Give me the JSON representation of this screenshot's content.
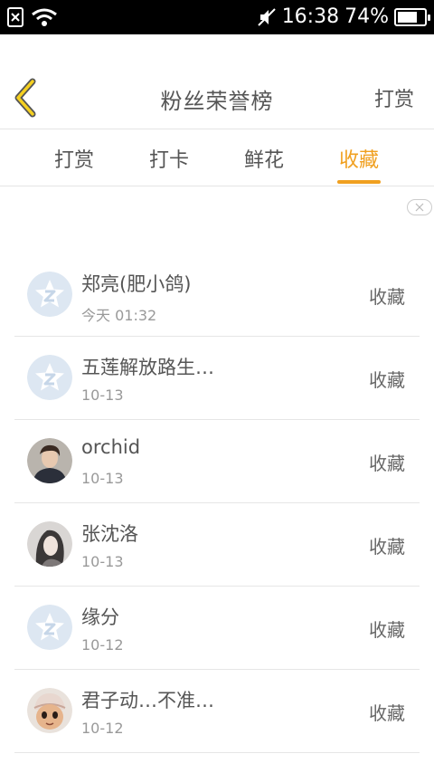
{
  "status_bar": {
    "time": "16:38",
    "battery_percent_text": "74%",
    "battery_level": 0.74
  },
  "header": {
    "title": "粉丝荣誉榜",
    "action_label": "打赏",
    "accent_color": "#f0a020"
  },
  "tabs": [
    {
      "label": "打赏",
      "active": false
    },
    {
      "label": "打卡",
      "active": false
    },
    {
      "label": "鲜花",
      "active": false
    },
    {
      "label": "收藏",
      "active": true
    }
  ],
  "fans": [
    {
      "name": "郑亮(肥小鸽)",
      "date": "今天 01:32",
      "action": "收藏",
      "avatar": "default-star-avatar"
    },
    {
      "name": "五莲解放路生…",
      "date": "10-13",
      "action": "收藏",
      "avatar": "default-star-avatar"
    },
    {
      "name": "orchid",
      "date": "10-13",
      "action": "收藏",
      "avatar": "photo-avatar-man"
    },
    {
      "name": "张沈洛",
      "date": "10-13",
      "action": "收藏",
      "avatar": "photo-avatar-woman"
    },
    {
      "name": "缘分",
      "date": "10-12",
      "action": "收藏",
      "avatar": "default-star-avatar"
    },
    {
      "name": "君子动…不准…",
      "date": "10-12",
      "action": "收藏",
      "avatar": "photo-avatar-doll"
    }
  ]
}
